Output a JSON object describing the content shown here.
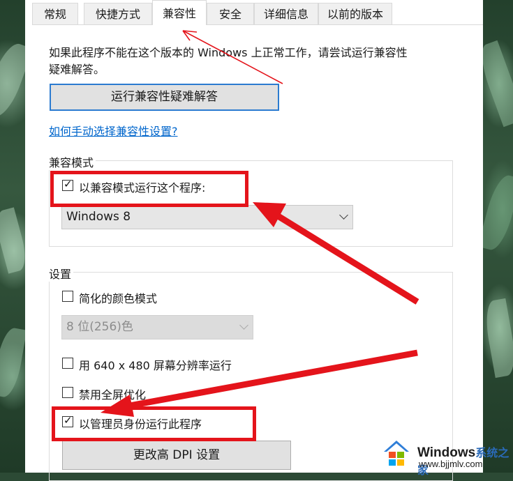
{
  "tabs": [
    {
      "label": "常规"
    },
    {
      "label": "快捷方式"
    },
    {
      "label": "兼容性"
    },
    {
      "label": "安全"
    },
    {
      "label": "详细信息"
    },
    {
      "label": "以前的版本"
    }
  ],
  "active_tab": "兼容性",
  "intro_text_line1": "如果此程序不能在这个版本的 Windows 上正常工作，请尝试运行兼容性",
  "intro_text_line2": "疑难解答。",
  "troubleshooter_button": "运行兼容性疑难解答",
  "manual_link": "如何手动选择兼容性设置?",
  "compat_mode": {
    "legend": "兼容模式",
    "checkbox_label": "以兼容模式运行这个程序:",
    "checked": true,
    "os_select_value": "Windows 8"
  },
  "settings": {
    "legend": "设置",
    "reduced_color": {
      "label": "简化的颜色模式",
      "checked": false
    },
    "color_select_value": "8 位(256)色",
    "res_640": {
      "label": "用 640 x 480 屏幕分辨率运行",
      "checked": false
    },
    "disable_fullscreen": {
      "label": "禁用全屏优化",
      "checked": false
    },
    "run_as_admin": {
      "label": "以管理员身份运行此程序",
      "checked": true
    },
    "dpi_button": "更改高 DPI 设置"
  },
  "watermark": {
    "brand": "Windows",
    "brand_cn": "系统之家",
    "url": "www.bjjmlv.com"
  },
  "annotation_color": "#e4141b"
}
